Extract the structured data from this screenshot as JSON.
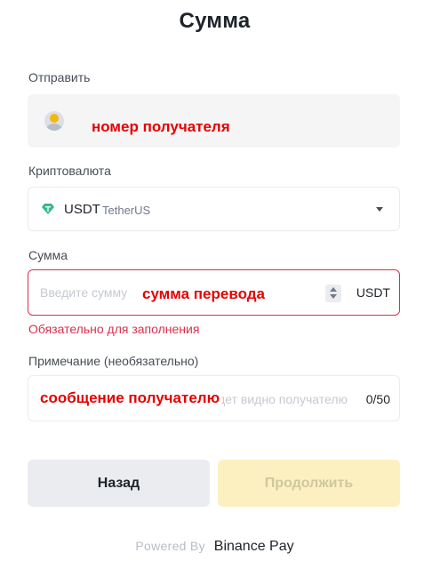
{
  "title": "Сумма",
  "send": {
    "label": "Отправить",
    "recipient_annotation": "номер получателя"
  },
  "crypto": {
    "label": "Криптовалюта",
    "ticker": "USDT",
    "name": "TetherUS",
    "icon": "tether-icon",
    "icon_color": "#2ebd85"
  },
  "amount": {
    "label": "Сумма",
    "placeholder": "Введите сумму",
    "annotation": "сумма перевода",
    "unit": "USDT",
    "error": "Обязательно для заполнения",
    "error_color": "#d9304e"
  },
  "note": {
    "label": "Примечание (необязательно)",
    "placeholder": "Будет видно получателю",
    "annotation": "сообщение получателю",
    "counter": "0/50"
  },
  "buttons": {
    "back": "Назад",
    "continue": "Продолжить"
  },
  "footer": {
    "powered_by": "Powered By",
    "brand": "Binance Pay"
  },
  "colors": {
    "accent_yellow": "#fcd535",
    "annotation_red": "#e60000"
  }
}
